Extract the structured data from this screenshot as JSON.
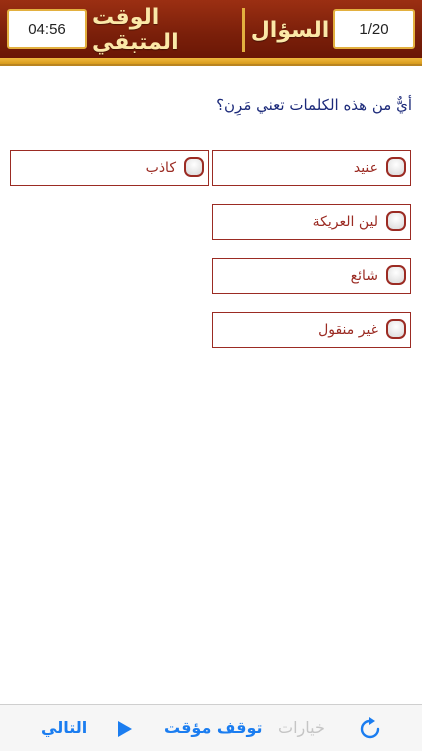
{
  "header": {
    "timer_value": "04:56",
    "remaining_label": "الوقت المتبقي",
    "question_label": "السؤال",
    "counter_value": "1/20"
  },
  "question": {
    "text": "أيٌّ من هذه الكلمات تعني مَرِن؟"
  },
  "options": [
    {
      "label": "عنيد"
    },
    {
      "label": "كاذب"
    },
    {
      "label": "لين العريكة"
    },
    {
      "label": "شائع"
    },
    {
      "label": "غير منقول"
    }
  ],
  "toolbar": {
    "next_label": "التالي",
    "pause_label": "توقف مؤقت",
    "options_label": "خيارات",
    "refresh_icon": "refresh-icon",
    "play_icon": "play-icon"
  },
  "colors": {
    "header": "#7a1f0a",
    "gold": "#e3b03f",
    "answer_border": "#9b2b23",
    "question_text": "#1c2a7a",
    "toolbar_accent": "#1b7df0"
  }
}
